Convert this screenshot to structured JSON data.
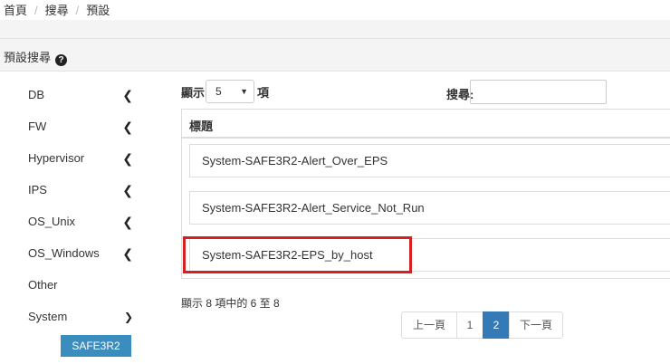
{
  "breadcrumb": {
    "home": "首頁",
    "search": "搜尋",
    "current": "預設"
  },
  "section": {
    "title": "預設搜尋"
  },
  "sidebar": {
    "items": [
      {
        "label": "DB",
        "icon": "chevron-left-icon"
      },
      {
        "label": "FW",
        "icon": "chevron-left-icon"
      },
      {
        "label": "Hypervisor",
        "icon": "chevron-left-icon"
      },
      {
        "label": "IPS",
        "icon": "chevron-left-icon"
      },
      {
        "label": "OS_Unix",
        "icon": "chevron-left-icon"
      },
      {
        "label": "OS_Windows",
        "icon": "chevron-left-icon"
      },
      {
        "label": "Other",
        "icon": ""
      },
      {
        "label": "System",
        "icon": "chevron-down-icon"
      }
    ],
    "sub_item": "SAFE3R2"
  },
  "length": {
    "prefix": "顯示",
    "value": "5",
    "suffix": "項"
  },
  "search": {
    "label": "搜尋:",
    "value": ""
  },
  "table": {
    "header": "標題",
    "rows": [
      "System-SAFE3R2-Alert_Over_EPS",
      "System-SAFE3R2-Alert_Service_Not_Run",
      "System-SAFE3R2-EPS_by_host"
    ]
  },
  "info": "顯示 8 項中的 6 至 8",
  "pagination": {
    "prev": "上一頁",
    "pages": [
      "1",
      "2"
    ],
    "current": "2",
    "next": "下一頁"
  },
  "colors": {
    "accent": "#337ab7",
    "sub_item_bg": "#3b8dbd",
    "highlight": "#d42020"
  }
}
